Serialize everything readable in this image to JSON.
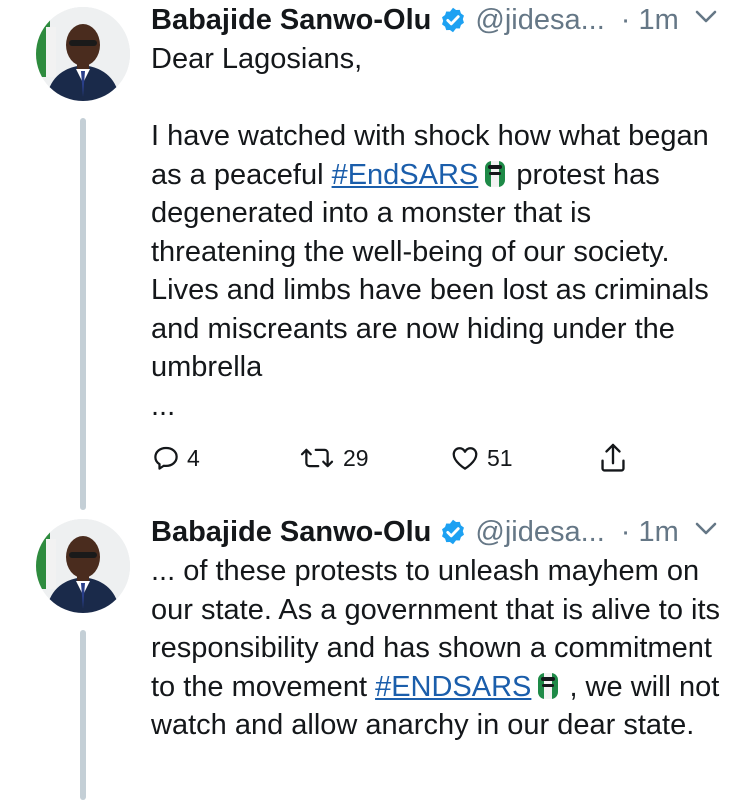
{
  "tweets": [
    {
      "author_name": "Babajide Sanwo-Olu",
      "handle": "@jidesa...",
      "time": "· 1m",
      "greeting": "Dear Lagosians,",
      "text_before_hashtag": "I have watched with shock how what began as a peaceful ",
      "hashtag": "#EndSARS",
      "text_after_hashtag": " protest has degenerated into a monster that is threatening the well-being of our society. Lives and limbs have been lost as criminals and miscreants are now hiding under the umbrella",
      "truncation": "...",
      "replies": "4",
      "retweets": "29",
      "likes": "51"
    },
    {
      "author_name": "Babajide Sanwo-Olu",
      "handle": "@jidesa...",
      "time": "· 1m",
      "text_before_hashtag": "... of these protests to unleash mayhem on our state. As a government that is alive to its responsibility and has shown a commitment to the movement ",
      "hashtag": "#ENDSARS",
      "text_after_hashtag": " , we will not watch and allow anarchy in our dear state."
    }
  ],
  "colors": {
    "text": "#14171a",
    "secondary": "#657786",
    "link": "#1b5eab",
    "verified": "#1da1f2",
    "thread_line": "#c4cfd6"
  },
  "icons": [
    "verified-badge-icon",
    "chevron-down-icon",
    "reply-icon",
    "retweet-icon",
    "like-icon",
    "share-icon",
    "raised-fist-emoji-icon"
  ]
}
